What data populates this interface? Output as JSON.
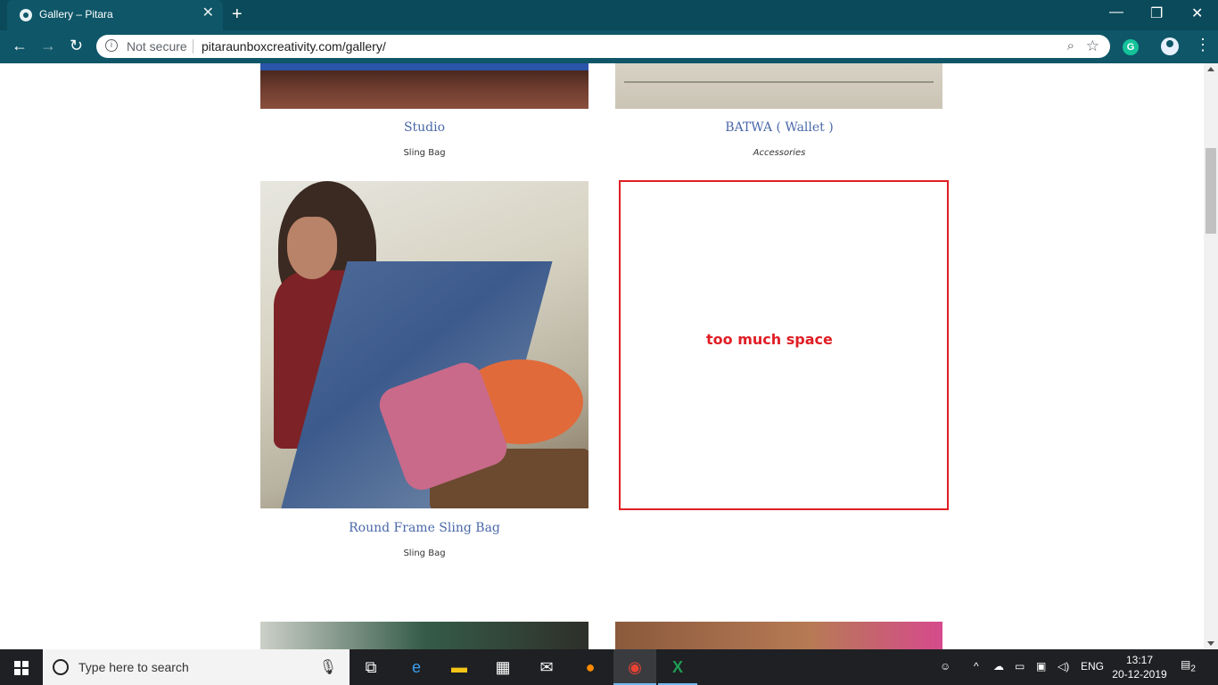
{
  "browser": {
    "tab_title": "Gallery – Pitara",
    "tab_close": "✕",
    "new_tab": "+",
    "security_label": "Not secure",
    "url": "pitaraunboxcreativity.com/gallery/",
    "window_controls": {
      "minimize": "—",
      "restore": "❐",
      "close": "✕"
    },
    "nav": {
      "back": "←",
      "forward": "→",
      "reload": "↻"
    },
    "menu": "⋮",
    "grammarly_icon": "G"
  },
  "gallery": {
    "items": [
      {
        "title": "Studio",
        "category": "Sling Bag"
      },
      {
        "title": "BATWA ( Wallet )",
        "category": "Accessories"
      },
      {
        "title": "Round Frame Sling Bag",
        "category": "Sling Bag"
      }
    ]
  },
  "annotation": {
    "text": "too much space",
    "color": "#e01e25"
  },
  "taskbar": {
    "search_placeholder": "Type here to search",
    "language": "ENG",
    "time": "13:17",
    "date": "20-12-2019",
    "notifications_count": "2"
  },
  "colors": {
    "chrome_dark": "#0b4a5a",
    "chrome_toolbar": "#0e5668",
    "caption_link": "#4a68a8"
  }
}
